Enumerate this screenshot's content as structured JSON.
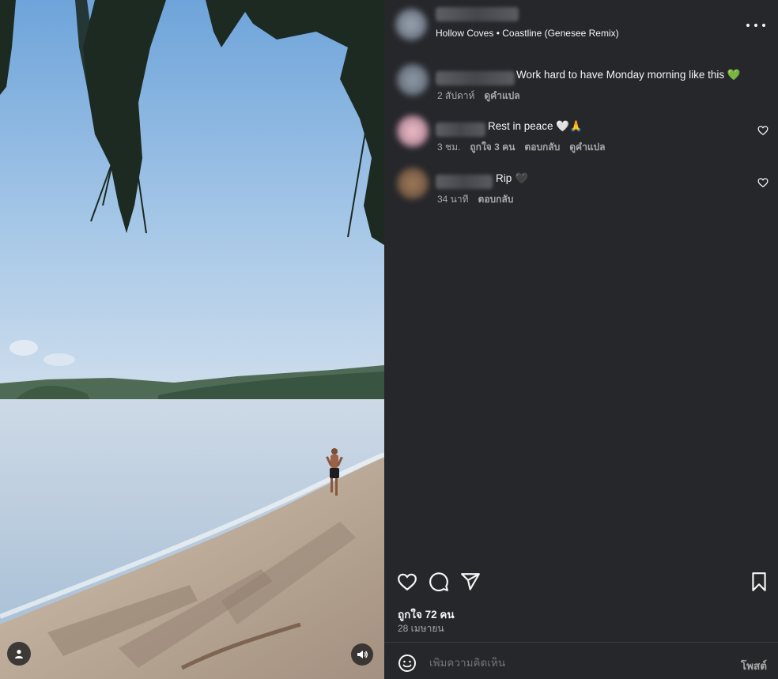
{
  "post": {
    "audio": "Hollow Coves • Coastline (Genesee Remix)",
    "more_icon": "more-horizontal-icon"
  },
  "comments": [
    {
      "text": "Work hard to have Monday morning like this",
      "emoji": "💚",
      "emoji_color": "#2ea043",
      "time": "2 สัปดาห์",
      "translate": "ดูคำแปล"
    },
    {
      "text": "Rest in peace",
      "emoji": "🤍🙏",
      "time": "3 ชม.",
      "likes": "ถูกใจ 3 คน",
      "reply": "ตอบกลับ",
      "translate": "ดูคำแปล"
    },
    {
      "text": "Rip",
      "emoji": "🖤",
      "time": "34 นาที",
      "reply": "ตอบกลับ"
    }
  ],
  "stats": {
    "likes": "ถูกใจ 72 คน",
    "date": "28 เมษายน"
  },
  "compose": {
    "placeholder": "เพิ่มความคิดเห็น",
    "post_label": "โพสต์"
  },
  "colors": {
    "panel_bg": "#26272b",
    "text": "#f5f5f5",
    "secondary": "#a8a8a8",
    "sky": "#8fb8e2",
    "sea": "#b7cbe0",
    "sand": "#c9b9a4"
  }
}
